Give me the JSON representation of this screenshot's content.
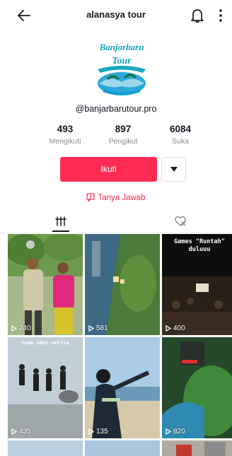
{
  "header": {
    "title": "alanasya tour",
    "back_icon": "arrow-left-icon",
    "bell_icon": "bell-icon",
    "more_icon": "more-vertical-icon"
  },
  "profile": {
    "avatar_text_line1": "Banjarbaru",
    "avatar_text_line2": "Tour",
    "handle": "@banjarbarutour.pro",
    "stats": [
      {
        "value": "493",
        "label": "Mengikuti"
      },
      {
        "value": "897",
        "label": "Pengikut"
      },
      {
        "value": "6084",
        "label": "Suka"
      }
    ],
    "follow_label": "Ikuti",
    "qa_label": "Tanya Jawab"
  },
  "tabs": [
    {
      "icon": "grid-icon",
      "active": true
    },
    {
      "icon": "liked-hidden-icon",
      "active": false
    }
  ],
  "colors": {
    "accent": "#fe2c55",
    "text": "#161823",
    "muted": "#8a8b91"
  },
  "videos": [
    {
      "views": "240",
      "caption": ""
    },
    {
      "views": "581",
      "caption": ""
    },
    {
      "views": "400",
      "caption": "Games \"Runtah\" duluuu"
    },
    {
      "views": "435",
      "caption": "team ikut selfie"
    },
    {
      "views": "135",
      "caption": ""
    },
    {
      "views": "820",
      "caption": ""
    }
  ]
}
